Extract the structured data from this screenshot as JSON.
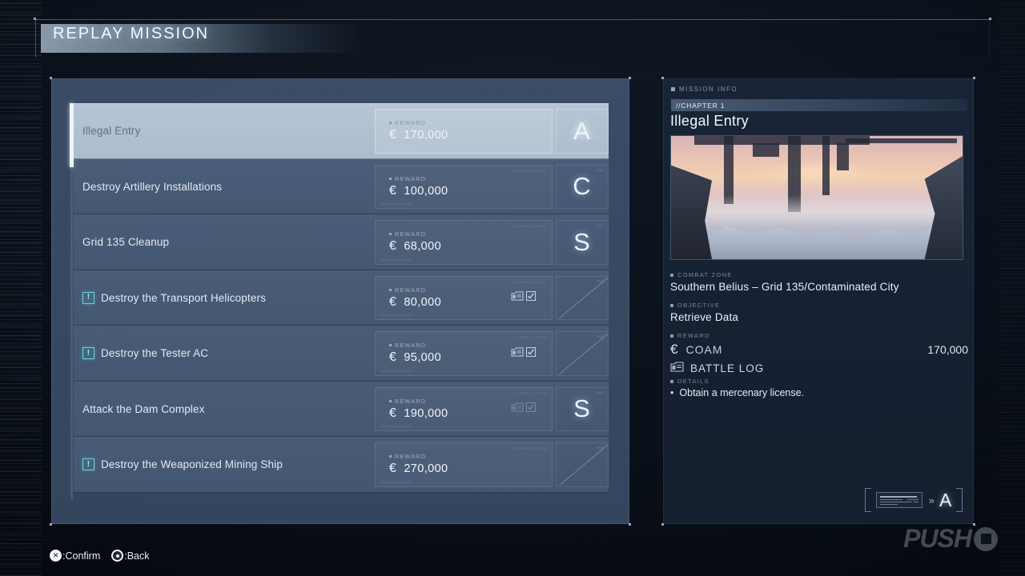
{
  "header": {
    "title": "REPLAY MISSION"
  },
  "missions": {
    "rows": [
      {
        "title": "Illegal Entry",
        "alert": false,
        "reward_label": "REWARD",
        "currency_symbol": "€",
        "reward_amount": "170,000",
        "rank": "A",
        "has_rank": true,
        "battle_log": "none",
        "selected": true,
        "micro_tr": "LOG DATA / 00-0124",
        "micro_bl": "MISSION RECORD"
      },
      {
        "title": "Destroy Artillery Installations",
        "alert": false,
        "reward_label": "REWARD",
        "currency_symbol": "€",
        "reward_amount": "100,000",
        "rank": "C",
        "has_rank": true,
        "battle_log": "none",
        "selected": false,
        "micro_tr": "LOG DATA / 00-0218",
        "micro_bl": "MISSION RECORD"
      },
      {
        "title": "Grid 135 Cleanup",
        "alert": false,
        "reward_label": "REWARD",
        "currency_symbol": "€",
        "reward_amount": "68,000",
        "rank": "S",
        "has_rank": true,
        "battle_log": "none",
        "selected": false,
        "micro_tr": "LOG DATA / 00-0305",
        "micro_bl": "MISSION RECORD"
      },
      {
        "title": "Destroy the Transport Helicopters",
        "alert": true,
        "reward_label": "REWARD",
        "currency_symbol": "€",
        "reward_amount": "80,000",
        "rank": "",
        "has_rank": false,
        "battle_log": "available",
        "selected": false,
        "micro_tr": "LOG DATA / 00-0411",
        "micro_bl": "MISSION RECORD"
      },
      {
        "title": "Destroy the Tester AC",
        "alert": true,
        "reward_label": "REWARD",
        "currency_symbol": "€",
        "reward_amount": "95,000",
        "rank": "",
        "has_rank": false,
        "battle_log": "available",
        "selected": false,
        "micro_tr": "LOG DATA / 00-0522",
        "micro_bl": "MISSION RECORD"
      },
      {
        "title": "Attack the Dam Complex",
        "alert": false,
        "reward_label": "REWARD",
        "currency_symbol": "€",
        "reward_amount": "190,000",
        "rank": "S",
        "has_rank": true,
        "battle_log": "collected",
        "selected": false,
        "micro_tr": "LOG DATA / 00-0630",
        "micro_bl": "MISSION RECORD"
      },
      {
        "title": "Destroy the Weaponized Mining Ship",
        "alert": true,
        "reward_label": "REWARD",
        "currency_symbol": "€",
        "reward_amount": "270,000",
        "rank": "",
        "has_rank": false,
        "battle_log": "none",
        "selected": false,
        "micro_tr": "LOG DATA / 00-0744",
        "micro_bl": "MISSION RECORD"
      }
    ]
  },
  "info": {
    "panel_label": "MISSION INFO",
    "chapter": "//CHAPTER 1",
    "mission_name": "Illegal Entry",
    "combat_zone_label": "COMBAT ZONE",
    "combat_zone": "Southern Belius – Grid 135/Contaminated City",
    "objective_label": "OBJECTIVE",
    "objective": "Retrieve Data",
    "reward_label": "REWARD",
    "coam_label": "COAM",
    "coam_symbol": "€",
    "coam_amount": "170,000",
    "battle_log_label": "BATTLE LOG",
    "details_label": "DETAILS",
    "detail_bullet": "•",
    "detail_text": "Obtain a mercenary license.",
    "summary_chevron": "»",
    "summary_rank": "A"
  },
  "footer": {
    "confirm_glyph": "✕",
    "confirm_label": ":Confirm",
    "back_label": ":Back"
  },
  "watermark": {
    "text": "PUSH"
  },
  "colors": {
    "accent_cyan": "#6fd3d8",
    "panel_blue": "#3c4f69",
    "row_blue": "#586c88",
    "selected_row": "#b6c5d5",
    "info_panel": "#192538",
    "text_primary": "#eaf1f8"
  }
}
